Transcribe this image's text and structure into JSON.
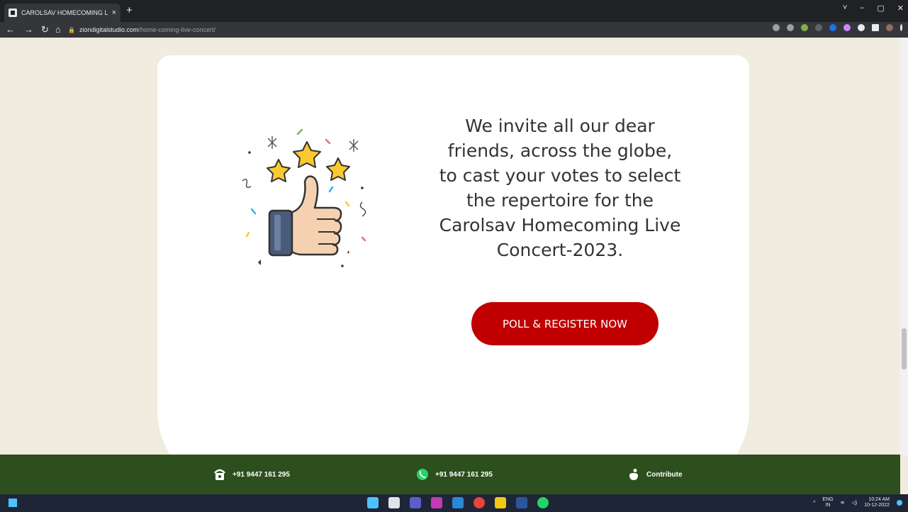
{
  "browser": {
    "tab_title": "CAROLSAV HOMECOMING LIVE",
    "tab_close": "×",
    "new_tab": "+",
    "url_host": "ziondigitalstudio.com",
    "url_path": "/home-coming-live-concert/",
    "window_controls": [
      "˅",
      "–",
      "▢",
      "✕"
    ]
  },
  "main": {
    "invite_lines": [
      "We invite all our dear",
      "friends, across the globe,",
      "to cast your votes to select",
      "the repertoire for the",
      "Carolsav Homecoming Live",
      "Concert-2023."
    ],
    "cta_label": "POLL & REGISTER NOW",
    "illustration_icon": "thumbs-up-stars-icon"
  },
  "footer": {
    "phone": "+91 9447 161 295",
    "whatsapp": "+91 9447 161 295",
    "contribute": "Contribute"
  },
  "taskbar": {
    "language": "ENG",
    "region": "IN",
    "time": "10:24 AM",
    "date": "10-12-2022"
  },
  "colors": {
    "page_bg": "#f0ece0",
    "cta_bg": "#c00000",
    "footer_bg": "#2d4f1e",
    "text": "#333333"
  }
}
